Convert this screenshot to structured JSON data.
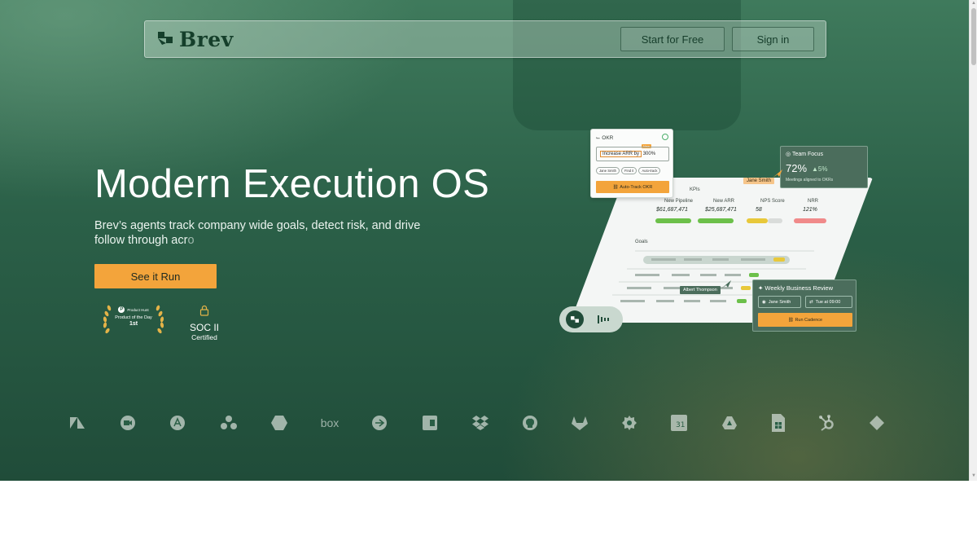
{
  "nav": {
    "brand": "Brev",
    "start_label": "Start for Free",
    "signin_label": "Sign in"
  },
  "hero": {
    "title": "Modern Execution OS",
    "subtitle": "Brev’s agents track company wide goals, detect risk, and drive follow through acr",
    "subtitle_fade": "o",
    "cta_label": "See it Run"
  },
  "badges": {
    "product_hunt": {
      "brand": "Product Hunt",
      "line": "Product of the Day",
      "rank": "1st"
    },
    "soc": {
      "title": "SOC II",
      "sub": "Certified"
    }
  },
  "mockup": {
    "kpis_label": "KPIs",
    "kpis": [
      {
        "name": "New Pipeline",
        "value": "$61,687,471"
      },
      {
        "name": "New ARR",
        "value": "$25,687,471"
      },
      {
        "name": "NPS Score",
        "value": "58"
      },
      {
        "name": "NRR",
        "value": "121%"
      }
    ],
    "goals_label": "Goals",
    "okr": {
      "title": "OKR",
      "field_prefix": "Increase ARR by",
      "field_value": "300%",
      "new_tag": "New",
      "chips": [
        "Jane Smith",
        "Find it",
        "Auto-track"
      ],
      "button": "Auto-Track OKR"
    },
    "team_focus": {
      "title": "Team Focus",
      "pct": "72%",
      "delta": "▲5%",
      "note": "Meetings aligned to OKRs"
    },
    "pointer_tag": "Jane Smith",
    "albert_tag": "Albert Thompson",
    "wbr": {
      "title": "Weekly Business Review",
      "owner": "Jane Smith",
      "time": "Tue at 09:00",
      "button": "Run Cadence"
    }
  },
  "integrations": {
    "items": [
      "zendesk-icon",
      "zoom-icon",
      "appstore-icon",
      "asana-icon",
      "hexagon-icon",
      "box-icon",
      "loop-icon",
      "clip-icon",
      "dropbox-icon",
      "github-icon",
      "gitlab-icon",
      "gear-icon",
      "calendar-icon",
      "drive-icon",
      "sheets-icon",
      "hubspot-icon",
      "diamond-icon"
    ],
    "box_text": "box"
  },
  "colors": {
    "accent": "#f3a43b",
    "hero_dark": "#204c39",
    "hero_light": "#3f7a5c"
  }
}
